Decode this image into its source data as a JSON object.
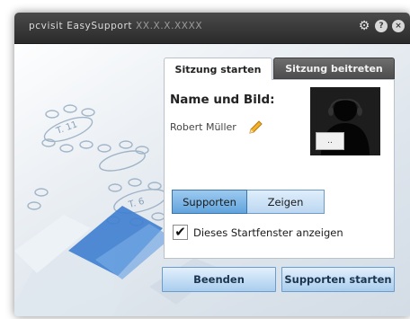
{
  "window": {
    "title": "pcvisit EasySupport",
    "version": "XX.X.X.XXXX",
    "controls": {
      "settings_icon": "gear-icon",
      "help_label": "?",
      "close_label": "×"
    }
  },
  "tabs": [
    {
      "label": "Sitzung starten",
      "active": true
    },
    {
      "label": "Sitzung beitreten",
      "active": false
    }
  ],
  "panel": {
    "heading": "Name und Bild:",
    "user_name": "Robert Müller",
    "edit_icon": "pencil-icon",
    "avatar_button_label": ".."
  },
  "mode": {
    "options": [
      "Supporten",
      "Zeigen"
    ],
    "selected": "Supporten"
  },
  "show_start_window": {
    "label": "Dieses Startfenster anzeigen",
    "checked": true,
    "mark": "✔"
  },
  "footer": {
    "quit_label": "Beenden",
    "start_label": "Supporten starten"
  },
  "colors": {
    "accent": "#62a4dd",
    "button": "#a9cdee",
    "titlebar": "#2a2a2a"
  }
}
